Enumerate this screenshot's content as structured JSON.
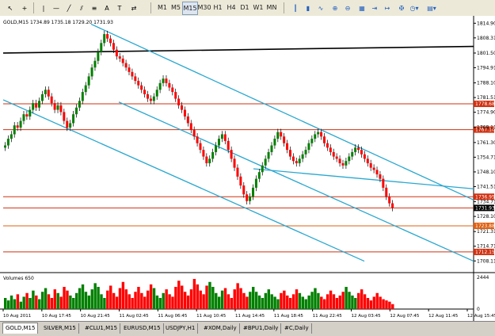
{
  "toolbar": {
    "timeframes": [
      "M1",
      "M5",
      "M15",
      "M30",
      "H1",
      "H4",
      "D1",
      "W1",
      "MN"
    ],
    "accent": "#1f5fbf"
  },
  "chart": {
    "info": "GOLD,M15  1734.89 1735.18 1729.20 1731.93",
    "volume_label": "Volumes 650",
    "volume_top_tick": "2444",
    "volume_bottom_tick": "0",
    "price_ticks": [
      "1814.90",
      "1808.31",
      "1801.50",
      "1794.91",
      "1788.10",
      "1781.51",
      "1774.90",
      "1768.11",
      "1761.30",
      "1754.71",
      "1748.10",
      "1741.51",
      "1734.71",
      "1728.10",
      "1721.31",
      "1714.71",
      "1708.11"
    ],
    "price_range": [
      1705.0,
      1817.5
    ],
    "time_labels": [
      "10 Aug 2011",
      "10 Aug 17:45",
      "10 Aug 21:45",
      "11 Aug 02:45",
      "11 Aug 06:45",
      "11 Aug 10:45",
      "11 Aug 14:45",
      "11 Aug 18:45",
      "11 Aug 22:45",
      "12 Aug 03:45",
      "12 Aug 07:45",
      "12 Aug 11:45",
      "12 Aug 15:45"
    ],
    "horizontal_levels": [
      {
        "price": 1778.68,
        "label": "1778.68",
        "color": "#d03010"
      },
      {
        "price": 1767.1,
        "label": "1767.10",
        "color": "#d03010"
      },
      {
        "price": 1736.95,
        "label": "1736.95",
        "color": "#d03010"
      },
      {
        "price": 1731.93,
        "label": "1731.93",
        "color": "#d03010",
        "current": true
      },
      {
        "price": 1723.88,
        "label": "1723.88",
        "color": "#e06010"
      },
      {
        "price": 1712.15,
        "label": "1712.15",
        "color": "#d03010"
      }
    ],
    "black_level": {
      "price_left": 1801.5,
      "price_right": 1804.5,
      "color": "#000000"
    },
    "trendline_color": "#2aa8d0",
    "up_color": "#008000",
    "down_color": "#ff0000",
    "price_series": [
      1760,
      1763,
      1765,
      1769,
      1768,
      1771,
      1774,
      1773,
      1776,
      1779,
      1777,
      1780,
      1783,
      1785,
      1782,
      1779,
      1776,
      1778,
      1775,
      1771,
      1768,
      1770,
      1774,
      1777,
      1780,
      1784,
      1787,
      1791,
      1795,
      1798,
      1802,
      1806,
      1810,
      1808,
      1806,
      1803,
      1800,
      1799,
      1797,
      1795,
      1793,
      1791,
      1789,
      1787,
      1785,
      1783,
      1781,
      1780,
      1782,
      1785,
      1788,
      1790,
      1788,
      1786,
      1784,
      1781,
      1778,
      1776,
      1773,
      1770,
      1767,
      1764,
      1761,
      1758,
      1755,
      1752,
      1754,
      1757,
      1760,
      1763,
      1765,
      1762,
      1758,
      1754,
      1750,
      1746,
      1742,
      1738,
      1735,
      1737,
      1741,
      1745,
      1748,
      1751,
      1754,
      1757,
      1760,
      1763,
      1766,
      1764,
      1761,
      1758,
      1755,
      1753,
      1752,
      1754,
      1756,
      1758,
      1761,
      1763,
      1765,
      1766,
      1764,
      1761,
      1759,
      1757,
      1755,
      1754,
      1752,
      1751,
      1753,
      1755,
      1757,
      1759,
      1758,
      1756,
      1754,
      1752,
      1750,
      1749,
      1747,
      1745,
      1741,
      1737,
      1734,
      1731.93
    ],
    "volume_series": [
      900,
      700,
      1100,
      800,
      1200,
      600,
      1000,
      1300,
      900,
      1500,
      1100,
      800,
      1400,
      1700,
      1200,
      900,
      1600,
      1300,
      1000,
      1800,
      1500,
      1100,
      900,
      1300,
      1700,
      2000,
      1400,
      1100,
      1600,
      2100,
      1800,
      1200,
      900,
      1500,
      1900,
      1300,
      1000,
      1700,
      2200,
      1600,
      1200,
      900,
      1400,
      1800,
      1300,
      1000,
      1500,
      2000,
      1700,
      1100,
      900,
      1300,
      1600,
      1200,
      1000,
      1800,
      2300,
      1900,
      1400,
      1100,
      1600,
      2444,
      2000,
      1500,
      1200,
      1900,
      2200,
      1800,
      1300,
      1000,
      1500,
      1700,
      1200,
      900,
      1600,
      2100,
      1700,
      1300,
      1000,
      1400,
      1800,
      1400,
      1100,
      900,
      1300,
      1600,
      1200,
      1000,
      800,
      1300,
      1500,
      1100,
      900,
      1200,
      1600,
      1300,
      1000,
      800,
      1100,
      1400,
      1700,
      1300,
      1000,
      800,
      1200,
      1500,
      1200,
      900,
      1100,
      1400,
      1800,
      1400,
      1100,
      900,
      1300,
      1600,
      1200,
      900,
      700,
      1000,
      1300,
      1000,
      800,
      700,
      600,
      400
    ]
  },
  "tabs": [
    "GOLD,M15",
    "SILVER,M15",
    "#CLU1,M15",
    "EURUSD,M15",
    "USDJPY,H1",
    "#XOM,Daily",
    "#BPU1,Daily",
    "#C,Daily"
  ]
}
